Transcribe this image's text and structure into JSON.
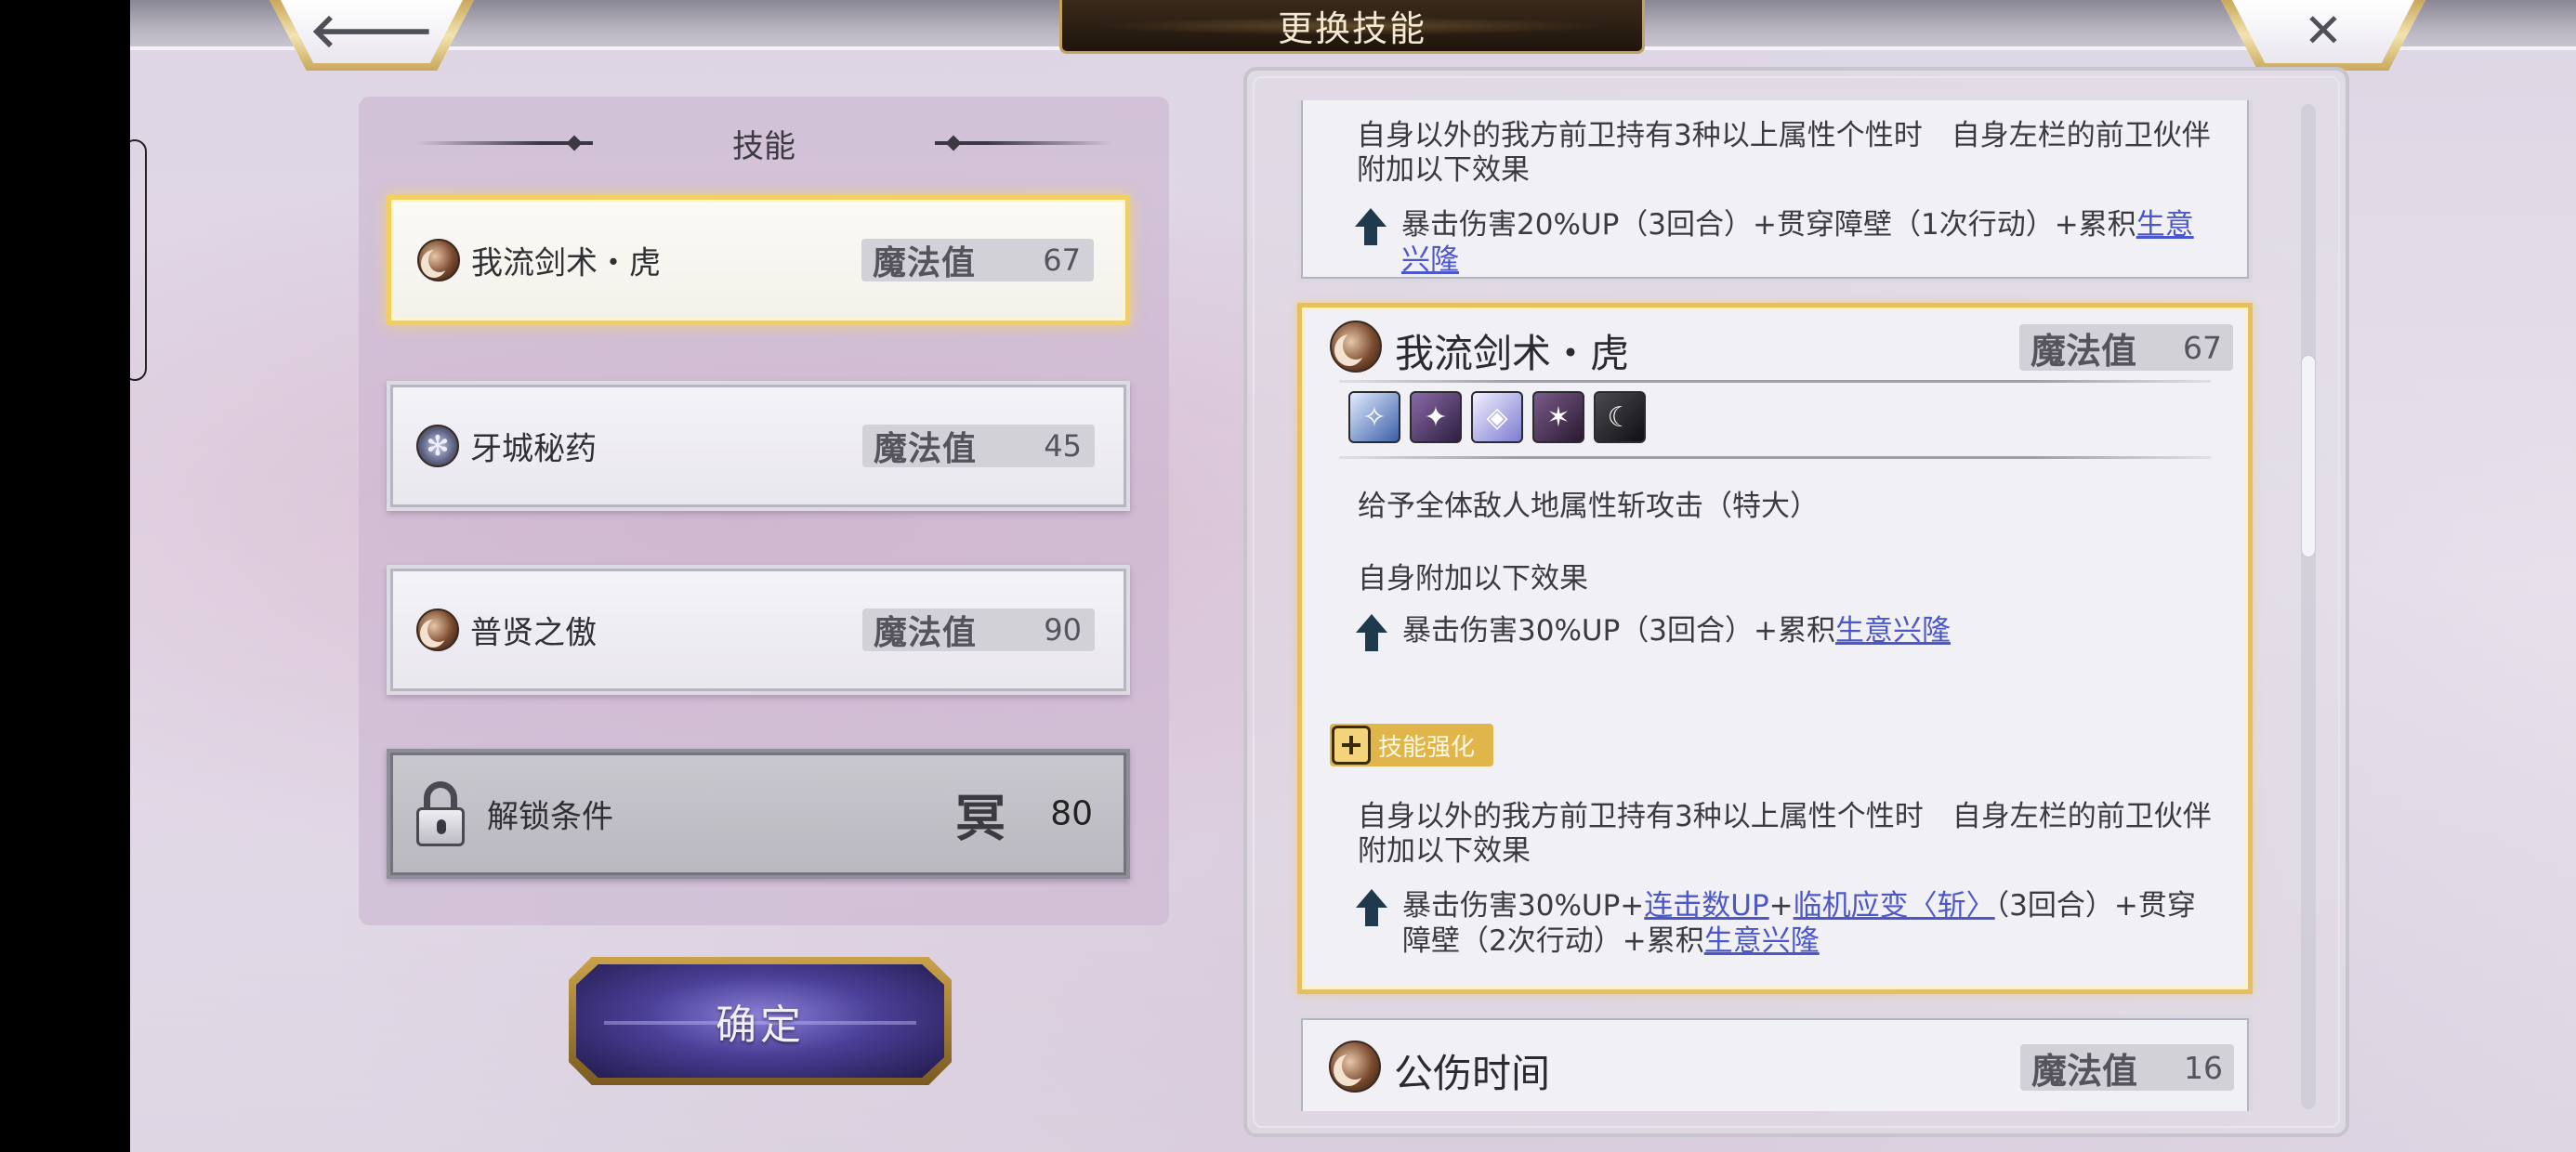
{
  "header": {
    "title": "更换技能",
    "back_icon": "back-arrow-icon",
    "close_icon": "close-icon"
  },
  "left_panel": {
    "title": "技能",
    "skills": [
      {
        "name": "我流剑术・虎",
        "icon": "moon-skill-icon",
        "mp_label": "魔法值",
        "mp": "67",
        "selected": true
      },
      {
        "name": "牙城秘药",
        "icon": "gear-skill-icon",
        "mp_label": "魔法值",
        "mp": "45",
        "selected": false
      },
      {
        "name": "普贤之傲",
        "icon": "moon-skill-icon",
        "mp_label": "魔法值",
        "mp": "90",
        "selected": false
      }
    ],
    "locked": {
      "label": "解锁条件",
      "glyph": "冥",
      "value": "80",
      "icon": "lock-icon"
    },
    "confirm_label": "确定"
  },
  "detail": {
    "prev_card": {
      "desc": "自身以外的我方前卫持有3种以上属性个性时　自身左栏的前卫伙伴附加以下效果",
      "effect_prefix": "暴击伤害20%UP（3回合）+贯穿障壁（1次行动）+累积",
      "effect_link": "生意兴隆"
    },
    "main_card": {
      "name": "我流剑术・虎",
      "mp_label": "魔法值",
      "mp": "67",
      "attributes": [
        "blue-element-icon",
        "purple-element-icon",
        "crystal-element-icon",
        "claw-element-icon",
        "crescent-element-icon"
      ],
      "desc1": "给予全体敌人地属性斩攻击（特大）",
      "desc2": "自身附加以下效果",
      "effect1_prefix": "暴击伤害30%UP（3回合）+累积",
      "effect1_link": "生意兴隆",
      "boost_label": "技能强化",
      "boost_desc": "自身以外的我方前卫持有3种以上属性个性时　自身左栏的前卫伙伴附加以下效果",
      "effect2_part1": "暴击伤害30%UP+",
      "effect2_link1": "连击数UP",
      "effect2_plus": "+",
      "effect2_link2": "临机应变〈斩〉",
      "effect2_part2": "（3回合）+贯穿障壁（2次行动）+累积",
      "effect2_link3": "生意兴隆"
    },
    "next_card": {
      "name": "公伤时间",
      "mp_label": "魔法值",
      "mp": "16"
    }
  },
  "colors": {
    "gold_accent": "#e6c060",
    "link": "#4c57c9",
    "title_plate": "#2a1d12"
  }
}
